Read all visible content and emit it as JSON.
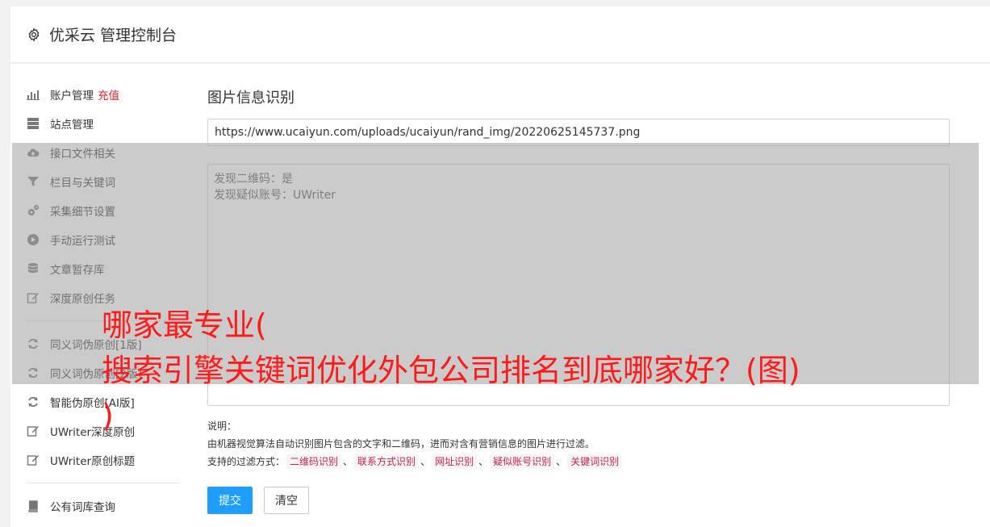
{
  "header": {
    "title": "优采云 管理控制台",
    "icon": "gear-icon"
  },
  "sidebar": {
    "items": [
      {
        "label": "账户管理",
        "badge": "充值",
        "icon": "bar-chart-icon"
      },
      {
        "label": "站点管理",
        "icon": "server-icon"
      },
      {
        "label": "接口文件相关",
        "icon": "cloud-upload-icon"
      },
      {
        "label": "栏目与关键词",
        "icon": "filter-icon"
      },
      {
        "label": "采集细节设置",
        "icon": "cogs-icon"
      },
      {
        "label": "手动运行测试",
        "icon": "play-circle-icon"
      },
      {
        "label": "文章暂存库",
        "icon": "database-icon"
      },
      {
        "label": "深度原创任务",
        "icon": "edit-icon"
      }
    ],
    "items2": [
      {
        "label": "同义词伪原创[1版]",
        "icon": "refresh-icon"
      },
      {
        "label": "同义词伪原创[2版]",
        "icon": "refresh-icon"
      },
      {
        "label": "智能伪原创[AI版]",
        "icon": "refresh-icon"
      },
      {
        "label": "UWriter深度原创",
        "icon": "edit-icon"
      },
      {
        "label": "UWriter原创标题",
        "icon": "edit-icon"
      }
    ],
    "items3": [
      {
        "label": "公有词库查询",
        "icon": "book-icon"
      }
    ]
  },
  "content": {
    "title": "图片信息识别",
    "url_value": "https://www.ucaiyun.com/uploads/ucaiyun/rand_img/20220625145737.png",
    "result_lines": [
      "发现二维码：是",
      "发现疑似账号：UWriter"
    ],
    "desc_label": "说明：",
    "desc_text": "由机器视觉算法自动识别图片包含的文字和二维码，进而对含有营销信息的图片进行过滤。",
    "filter_label": "支持的过滤方式：",
    "filters": [
      "二维码识别",
      "联系方式识别",
      "网址识别",
      "疑似账号识别",
      "关键词识别"
    ],
    "filter_sep": "、",
    "submit_label": "提交",
    "clear_label": "清空"
  },
  "overlay_text": {
    "line1": "哪家最专业(",
    "line2": "搜索引擎关键词优化外包公司排名到底哪家好？(图)",
    "line3": ")"
  },
  "colors": {
    "primary": "#1e9fff",
    "badge": "#e02020",
    "headline": "#ff1a1a",
    "tag_text": "#c7254e"
  }
}
